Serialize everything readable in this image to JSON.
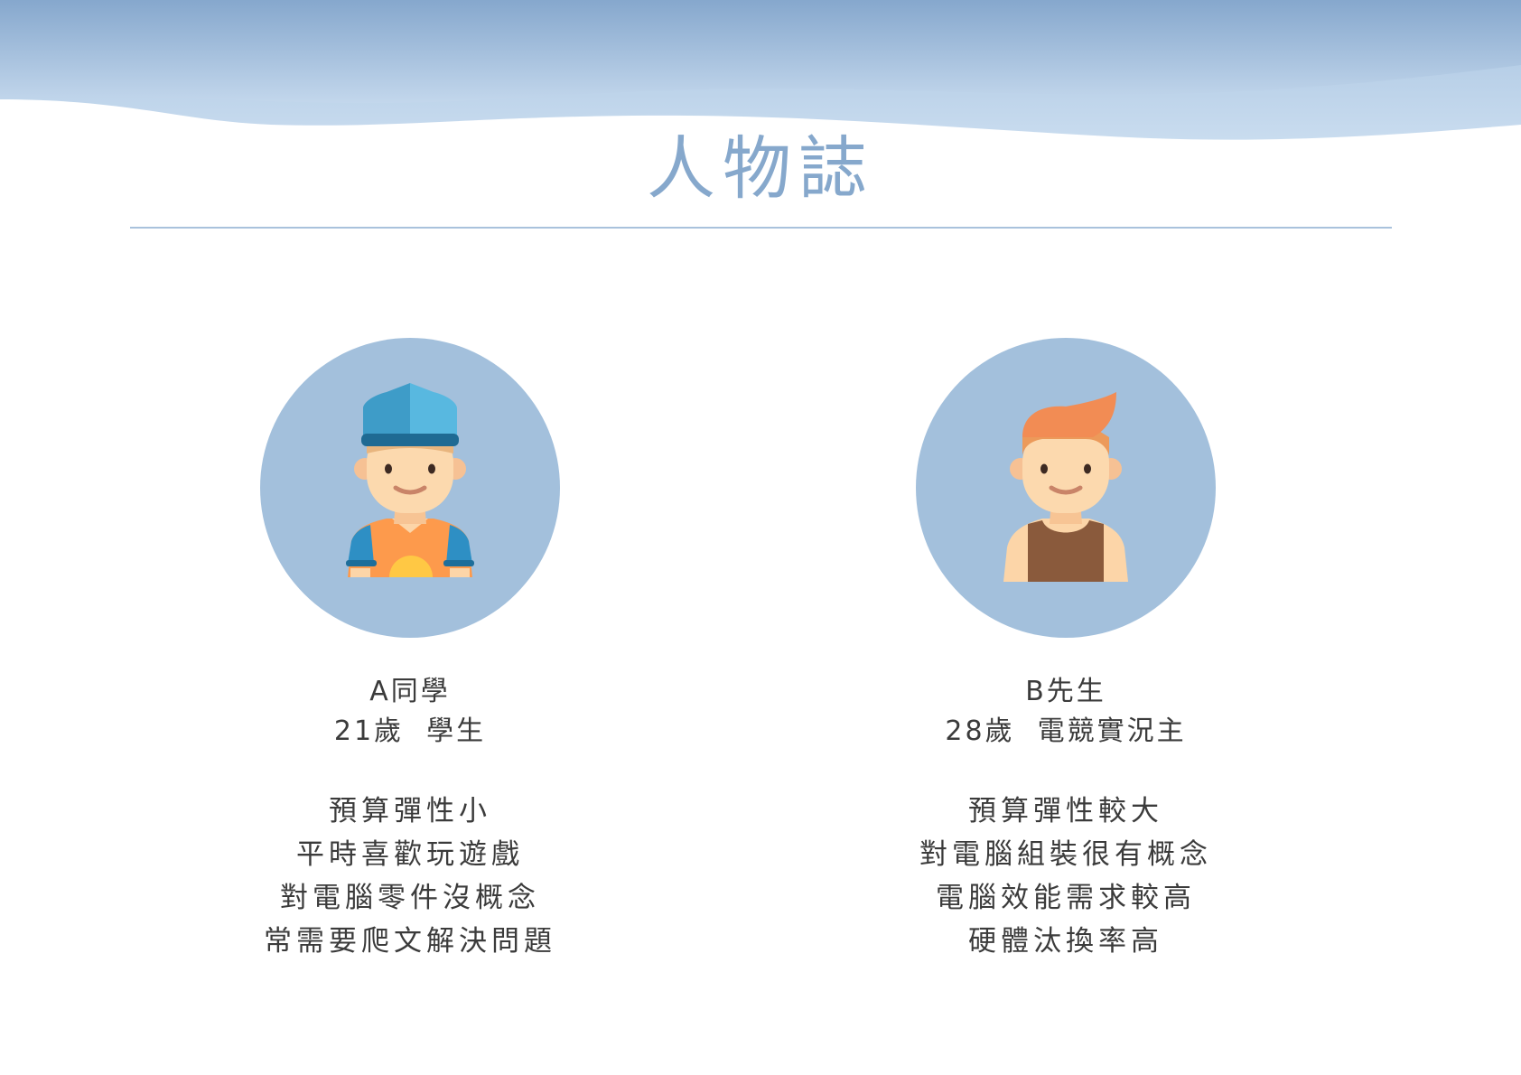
{
  "page": {
    "title": "人物誌"
  },
  "personas": [
    {
      "avatar": "boy-with-cap-icon",
      "name": "A同學",
      "info": "21歲  學生",
      "traits": [
        "預算彈性小",
        "平時喜歡玩遊戲",
        "對電腦零件沒概念",
        "常需要爬文解決問題"
      ]
    },
    {
      "avatar": "man-in-tank-top-icon",
      "name": "B先生",
      "info": "28歲  電競實況主",
      "traits": [
        "預算彈性較大",
        "對電腦組裝很有概念",
        "電腦效能需求較高",
        "硬體汰換率高"
      ]
    }
  ],
  "colors": {
    "accent": "#86a8cc",
    "circle": "#a3c0dc",
    "banner_top": "#87a9cf",
    "banner_bottom": "#c1d6ec"
  }
}
